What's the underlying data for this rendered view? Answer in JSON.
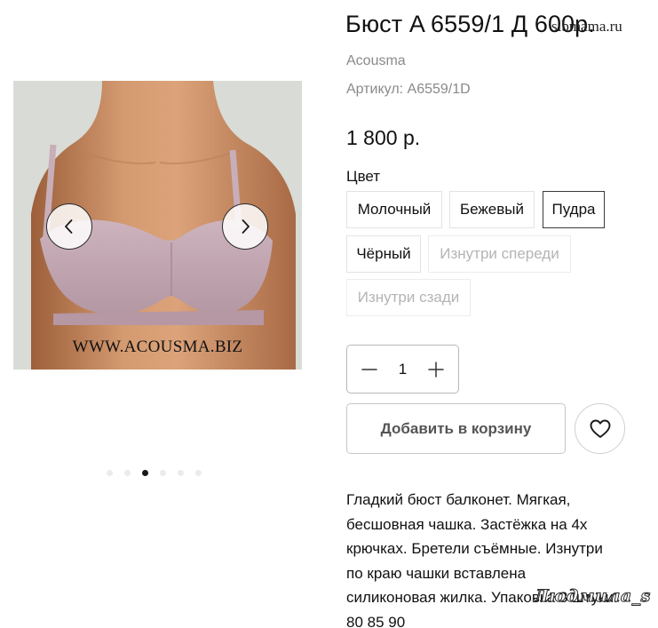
{
  "product": {
    "title": "Бюст A 6559/1 Д 600р.",
    "brand": "Acousma",
    "sku": "Артикул: A6559/1D",
    "price": "1 800 р."
  },
  "overlays": {
    "site": "sibmama.ru",
    "signature": "Людмила_s"
  },
  "gallery": {
    "watermark": "WWW.ACOUSMA.BIZ",
    "slide_count": 6,
    "active_slide": 3,
    "colors": {
      "background": "#d9dbd6",
      "garment": "#c4aab4",
      "skin": "#c98f66"
    }
  },
  "color_picker": {
    "label": "Цвет",
    "options": [
      {
        "label": "Молочный",
        "state": "available"
      },
      {
        "label": "Бежевый",
        "state": "available"
      },
      {
        "label": "Пудра",
        "state": "selected"
      },
      {
        "label": "Чёрный",
        "state": "available"
      },
      {
        "label": "Изнутри спереди",
        "state": "unavailable"
      },
      {
        "label": "Изнутри сзади",
        "state": "unavailable"
      }
    ]
  },
  "quantity": {
    "value": "1",
    "decrease_icon": "minus-icon",
    "increase_icon": "plus-icon"
  },
  "actions": {
    "add_to_cart": "Добавить в корзину",
    "favorite_icon": "heart-icon"
  },
  "description": {
    "lines": [
      "Гладкий бюст балконет. Мягкая,",
      "бесшовная чашка. Застёжка на 4х",
      "крючках. Бретели съёмные. Изнутри",
      "по краю чашки вставлена",
      "силиконовая жилка. Упаковка 3 штуки.",
      "80 85 90"
    ]
  }
}
